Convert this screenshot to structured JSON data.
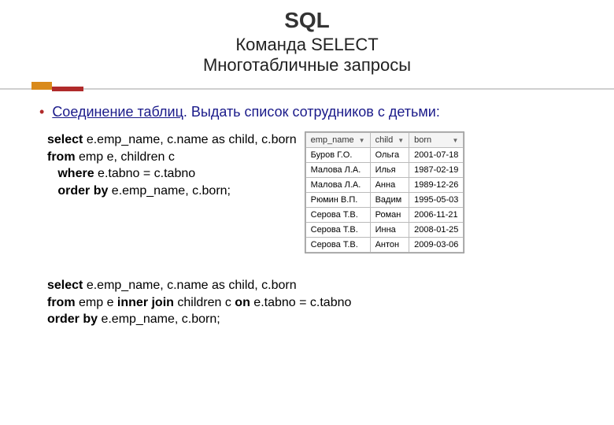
{
  "header": {
    "title": "SQL",
    "subtitle1": "Команда SELECT",
    "subtitle2": "Многотабличные запросы"
  },
  "bullet": {
    "link_text": "Соединение таблиц",
    "rest_text": ". Выдать список сотрудников с детьми:"
  },
  "query1": {
    "kw_select": "select",
    "select_cols": " e.emp_name, c.name as child, c.born",
    "kw_from": "from",
    "from_txt": " emp e, children c",
    "kw_where": "where",
    "where_txt": " e.tabno = c.tabno",
    "kw_order": "order by",
    "order_txt": " e.emp_name, c.born;"
  },
  "query2": {
    "kw_select": "select",
    "select_cols": " e.emp_name, c.name as child, c.born",
    "kw_from": "from",
    "from_txt1": " emp e ",
    "kw_join": "inner join",
    "from_txt2": " children c  ",
    "kw_on": "on",
    "from_txt3": " e.tabno = c.tabno",
    "kw_order": "order by",
    "order_txt": " e.emp_name, c.born;"
  },
  "table": {
    "headers": [
      "emp_name",
      "child",
      "born"
    ],
    "rows": [
      [
        "Буров Г.О.",
        "Ольга",
        "2001-07-18"
      ],
      [
        "Малова Л.А.",
        "Илья",
        "1987-02-19"
      ],
      [
        "Малова Л.А.",
        "Анна",
        "1989-12-26"
      ],
      [
        "Рюмин В.П.",
        "Вадим",
        "1995-05-03"
      ],
      [
        "Серова Т.В.",
        "Роман",
        "2006-11-21"
      ],
      [
        "Серова Т.В.",
        "Инна",
        "2008-01-25"
      ],
      [
        "Серова Т.В.",
        "Антон",
        "2009-03-06"
      ]
    ]
  }
}
